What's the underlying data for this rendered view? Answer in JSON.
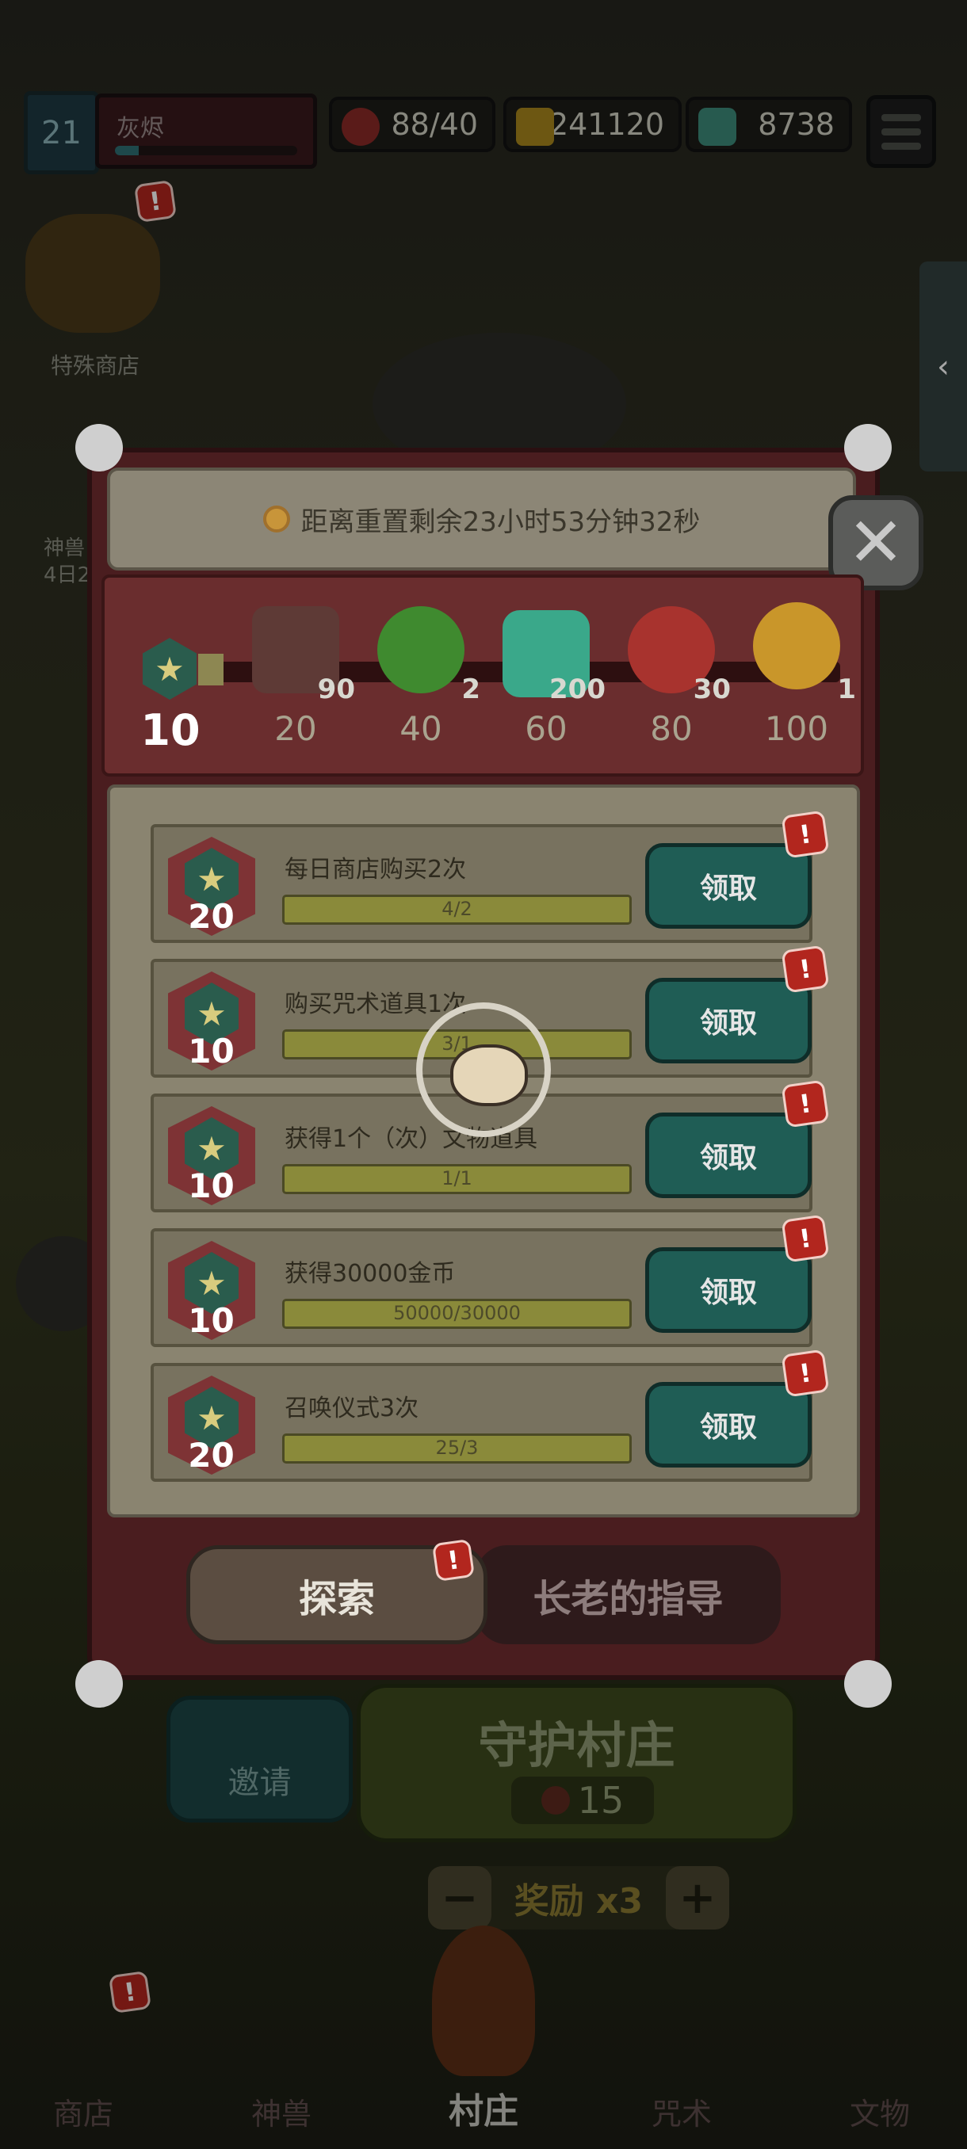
{
  "player": {
    "level": "21",
    "name": "灰烬",
    "xp_fraction": 0.13
  },
  "resources": [
    {
      "icon": "meat-icon",
      "value": "88/40"
    },
    {
      "icon": "gold-icon",
      "value": "241120"
    },
    {
      "icon": "gem-icon",
      "value": "8738"
    }
  ],
  "side": {
    "special_shop_label": "特殊商店",
    "beast_label": "神兽",
    "beast_timer": "4日2",
    "collapse_glyph": "‹"
  },
  "modal": {
    "timer_text": "距离重置剩余23小时53分钟32秒",
    "close_glyph": "✕",
    "current_points": "10",
    "milestones": [
      {
        "threshold": "20",
        "icon": "banner-icon",
        "count": "90"
      },
      {
        "threshold": "40",
        "icon": "paw-leaf-icon",
        "count": "2"
      },
      {
        "threshold": "60",
        "icon": "gem-icon",
        "count": "200"
      },
      {
        "threshold": "80",
        "icon": "meat-icon",
        "count": "30"
      },
      {
        "threshold": "100",
        "icon": "key-icon",
        "count": "1"
      }
    ],
    "tasks": [
      {
        "title": "每日商店购买2次",
        "points": "20",
        "progress": "4/2",
        "button": "领取"
      },
      {
        "title": "购买咒术道具1次",
        "points": "10",
        "progress": "3/1",
        "button": "领取"
      },
      {
        "title": "获得1个（次）文物道具",
        "points": "10",
        "progress": "1/1",
        "button": "领取"
      },
      {
        "title": "获得30000金币",
        "points": "10",
        "progress": "50000/30000",
        "button": "领取"
      },
      {
        "title": "召唤仪式3次",
        "points": "20",
        "progress": "25/3",
        "button": "领取"
      }
    ],
    "tabs": {
      "explore": "探索",
      "elder": "长老的指导"
    }
  },
  "background_ui": {
    "invite": "邀请",
    "defend_title": "守护村庄",
    "defend_cost": "15",
    "bonus": "奖励 x3",
    "minus": "−",
    "plus": "+"
  },
  "nav": [
    "商店",
    "神兽",
    "村庄",
    "咒术",
    "文物"
  ],
  "colors": {
    "accent_teal": "#1f5d55",
    "alert_red": "#b2261e",
    "frame_dark_red": "#4a1d1f"
  }
}
